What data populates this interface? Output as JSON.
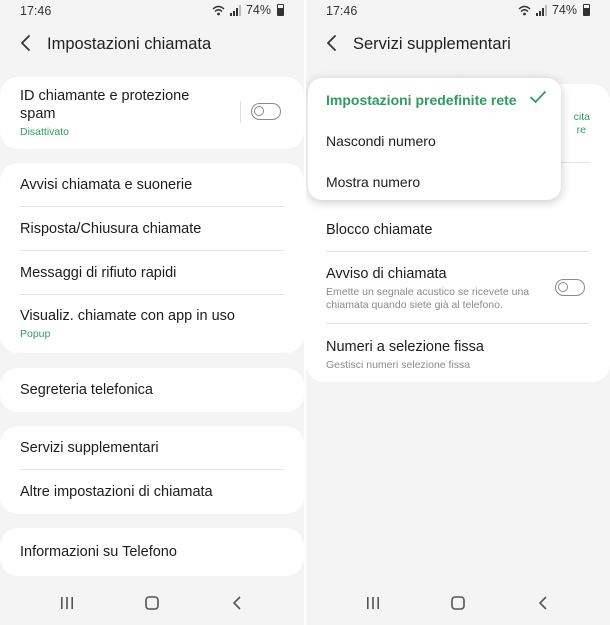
{
  "left": {
    "status": {
      "time": "17:46",
      "battery": "74%"
    },
    "title": "Impostazioni chiamata",
    "cards": [
      {
        "items": [
          {
            "label": "ID chiamante e protezione spam",
            "sub": "Disattivato"
          }
        ]
      },
      {
        "items": [
          {
            "label": "Avvisi chiamata e suonerie"
          },
          {
            "label": "Risposta/Chiusura chiamate"
          },
          {
            "label": "Messaggi di rifiuto rapidi"
          },
          {
            "label": "Visualiz. chiamate con app in uso",
            "sub": "Popup"
          }
        ]
      },
      {
        "items": [
          {
            "label": "Segreteria telefonica"
          }
        ]
      },
      {
        "items": [
          {
            "label": "Servizi supplementari"
          },
          {
            "label": "Altre impostazioni di chiamata"
          }
        ]
      },
      {
        "items": [
          {
            "label": "Informazioni su Telefono"
          }
        ]
      }
    ]
  },
  "right": {
    "status": {
      "time": "17:46",
      "battery": "74%"
    },
    "title": "Servizi supplementari",
    "hidden_text_1": "cita",
    "hidden_text_2": "re",
    "popup_options": [
      {
        "label": "Impostazioni predefinite rete",
        "selected": true
      },
      {
        "label": "Nascondi numero"
      },
      {
        "label": "Mostra numero"
      }
    ],
    "items": [
      {
        "label": "Blocco chiamate"
      },
      {
        "label": "Avviso di chiamata",
        "desc": "Emette un segnale acustico se ricevete una chiamata quando siete già al telefono."
      },
      {
        "label": "Numeri a selezione fissa",
        "desc": "Gestisci numeri selezione fissa"
      }
    ]
  },
  "colors": {
    "accent": "#2d9c5e",
    "background": "#f4f4f4",
    "card": "#ffffff"
  },
  "icons": {
    "back": "chevron-left-icon",
    "recents": "recents-icon",
    "home": "home-icon",
    "nav_back": "nav-back-icon",
    "wifi": "wifi-icon",
    "signal": "signal-icon",
    "battery": "battery-icon",
    "check": "check-icon"
  }
}
